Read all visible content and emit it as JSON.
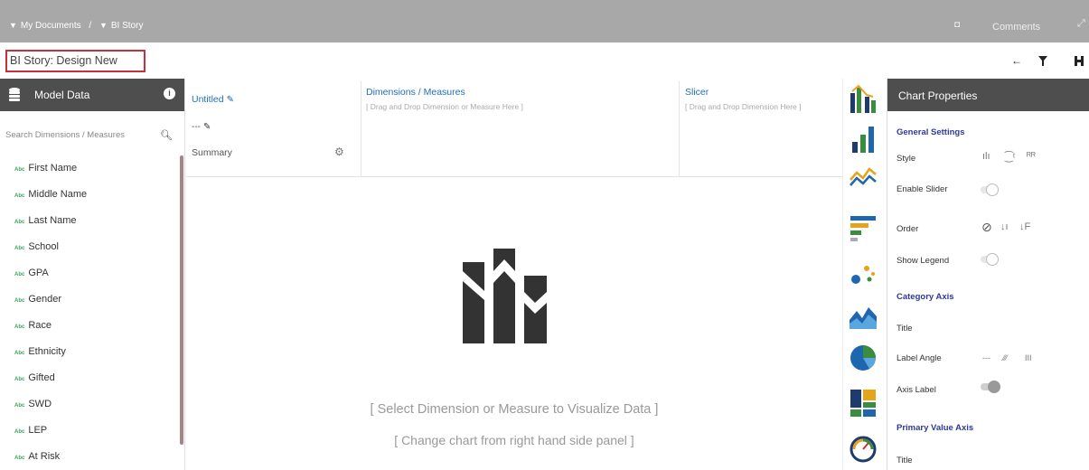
{
  "breadcrumb": {
    "root": "My Documents",
    "separator": "/",
    "current": "BI Story"
  },
  "topbar": {
    "comments_label": "Comments"
  },
  "story": {
    "title": "BI Story: Design New"
  },
  "model_panel": {
    "title": "Model Data",
    "search_placeholder": "Search Dimensions / Measures",
    "field_type_badge": "Abc",
    "fields": [
      "First Name",
      "Middle Name",
      "Last Name",
      "School",
      "GPA",
      "Gender",
      "Race",
      "Ethnicity",
      "Gifted",
      "SWD",
      "LEP",
      "At Risk"
    ]
  },
  "config": {
    "name": "Untitled",
    "sub": "---",
    "summary": "Summary",
    "dimensions_title": "Dimensions / Measures",
    "dimensions_hint": "[ Drag and Drop Dimension or Measure Here ]",
    "slicer_title": "Slicer",
    "slicer_hint": "[ Drag and Drop Dimension Here ]"
  },
  "canvas": {
    "message1": "[ Select Dimension or Measure to Visualize Data ]",
    "message2": "[ Change chart from right hand side panel ]"
  },
  "chart_types": [
    "combo-chart-icon",
    "bar-chart-icon",
    "line-chart-icon",
    "horizontal-bar-icon",
    "scatter-chart-icon",
    "area-chart-icon",
    "pie-chart-icon",
    "treemap-icon",
    "gauge-icon"
  ],
  "properties": {
    "title": "Chart Properties",
    "general_settings": "General Settings",
    "style": "Style",
    "enable_slider": "Enable Slider",
    "order": "Order",
    "show_legend": "Show Legend",
    "category_axis": "Category Axis",
    "title_label": "Title",
    "label_angle": "Label Angle",
    "axis_label": "Axis Label",
    "primary_value_axis": "Primary Value Axis",
    "title_label_2": "Title",
    "enable_slider_on": false,
    "show_legend_on": false,
    "axis_label_on": true
  },
  "colors": {
    "topbar": "#a8a8a8",
    "panel_header": "#4e4e4e",
    "accent_blue": "#1e6fb8",
    "section_blue": "#2a3a9e",
    "highlight_red": "#c9303c"
  }
}
